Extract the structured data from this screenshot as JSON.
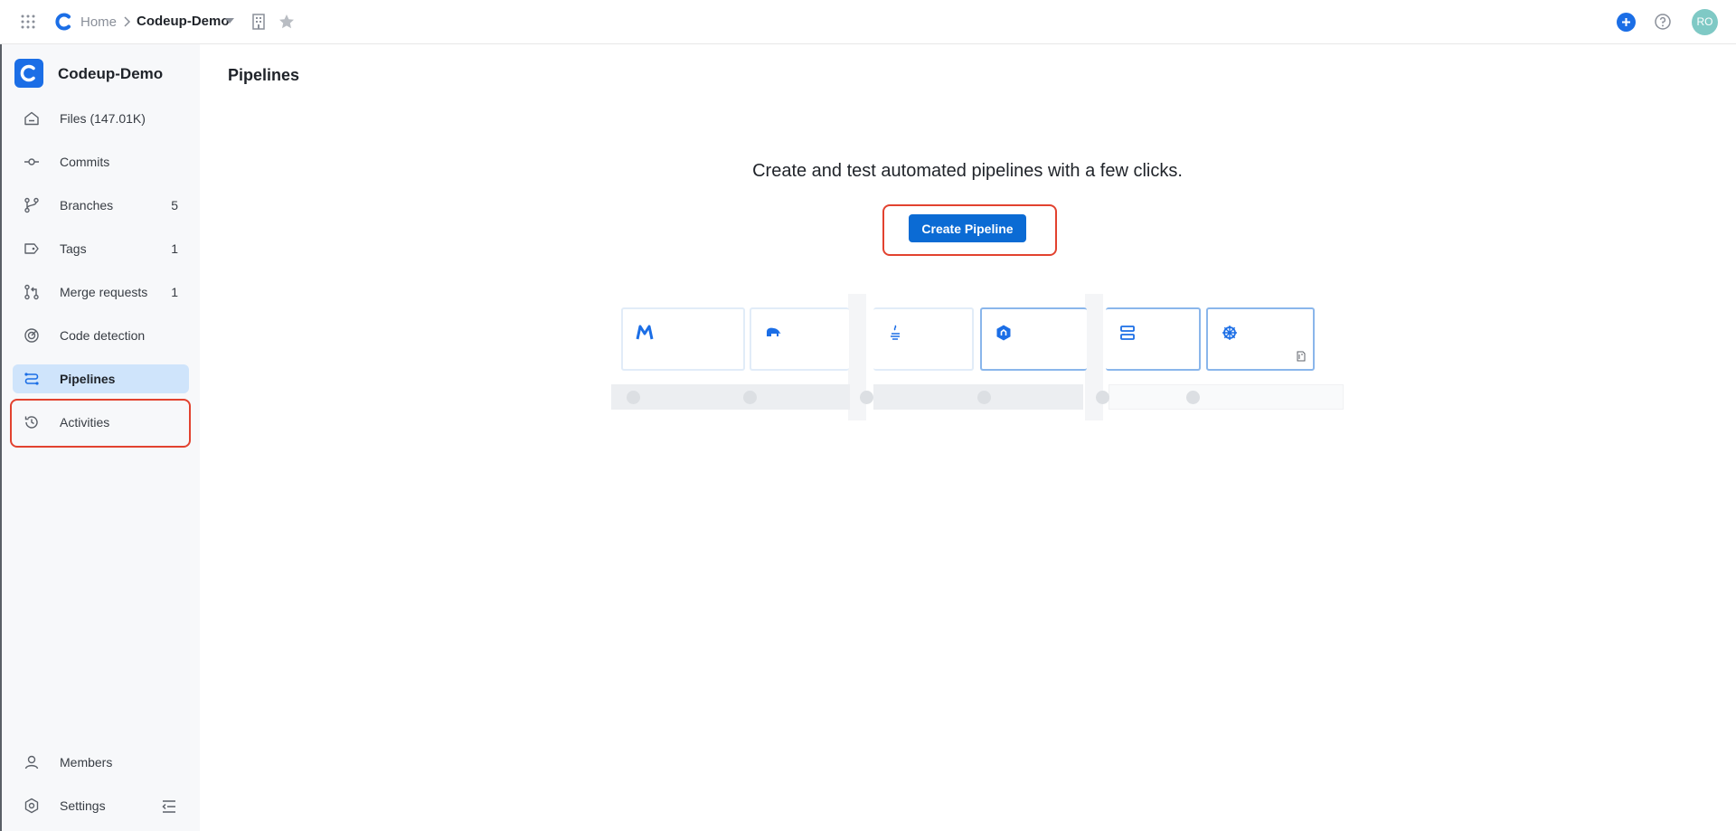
{
  "topbar": {
    "home_label": "Home",
    "repo_name": "Codeup-Demo",
    "avatar_initials": "RO"
  },
  "sidebar": {
    "title": "Codeup-Demo",
    "items": [
      {
        "label": "Files (147.01K)",
        "count": "",
        "icon": "home-icon"
      },
      {
        "label": "Commits",
        "count": "",
        "icon": "commit-icon"
      },
      {
        "label": "Branches",
        "count": "5",
        "icon": "branch-icon"
      },
      {
        "label": "Tags",
        "count": "1",
        "icon": "tag-icon"
      },
      {
        "label": "Merge requests",
        "count": "1",
        "icon": "merge-request-icon"
      },
      {
        "label": "Code detection",
        "count": "",
        "icon": "code-detection-icon"
      },
      {
        "label": "Pipelines",
        "count": "",
        "icon": "pipeline-icon",
        "active": true
      },
      {
        "label": "Activities",
        "count": "",
        "icon": "history-icon"
      }
    ],
    "bottom_items": [
      {
        "label": "Members",
        "icon": "user-icon"
      },
      {
        "label": "Settings",
        "icon": "settings-icon"
      }
    ]
  },
  "main": {
    "page_title": "Pipelines",
    "empty_message": "Create and test automated pipelines with a few clicks.",
    "cta_label": "Create Pipeline"
  },
  "colors": {
    "accent": "#0b6bd4",
    "highlight": "#e2422f",
    "active_nav_bg": "#cfe4fb"
  }
}
